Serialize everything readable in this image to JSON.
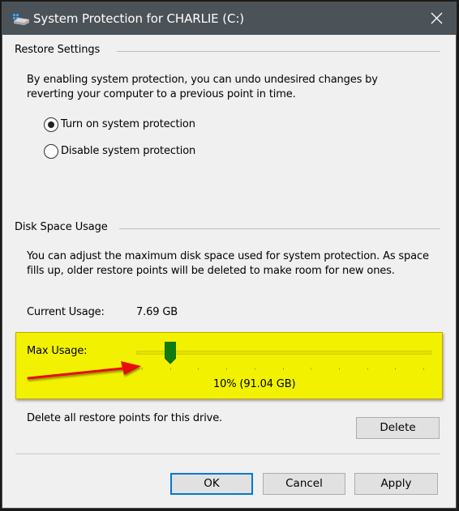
{
  "window": {
    "title": "System Protection for CHARLIE (C:)",
    "icon": "drive-protection-icon",
    "close_icon": "close-icon"
  },
  "restore_settings": {
    "group_label": "Restore Settings",
    "description_line1": "By enabling system protection, you can undo undesired changes by",
    "description_line2": "reverting your computer to a previous point in time.",
    "options": [
      {
        "label": "Turn on system protection",
        "checked": true
      },
      {
        "label": "Disable system protection",
        "checked": false
      }
    ]
  },
  "disk_space": {
    "group_label": "Disk Space Usage",
    "description_line1": "You can adjust the maximum disk space used for system protection. As space",
    "description_line2": "fills up, older restore points will be deleted to make room for new ones.",
    "current_usage_label": "Current Usage:",
    "current_usage_value": "7.69 GB",
    "max_usage_label": "Max Usage:",
    "max_usage_percent": 10,
    "max_usage_readout": "10% (91.04 GB)",
    "tick_count": 11,
    "highlight_color": "#f2f200",
    "thumb_color": "#107c10",
    "arrow_color": "#e81010"
  },
  "delete": {
    "description": "Delete all restore points for this drive.",
    "button_label": "Delete"
  },
  "footer": {
    "ok_label": "OK",
    "cancel_label": "Cancel",
    "apply_label": "Apply"
  }
}
